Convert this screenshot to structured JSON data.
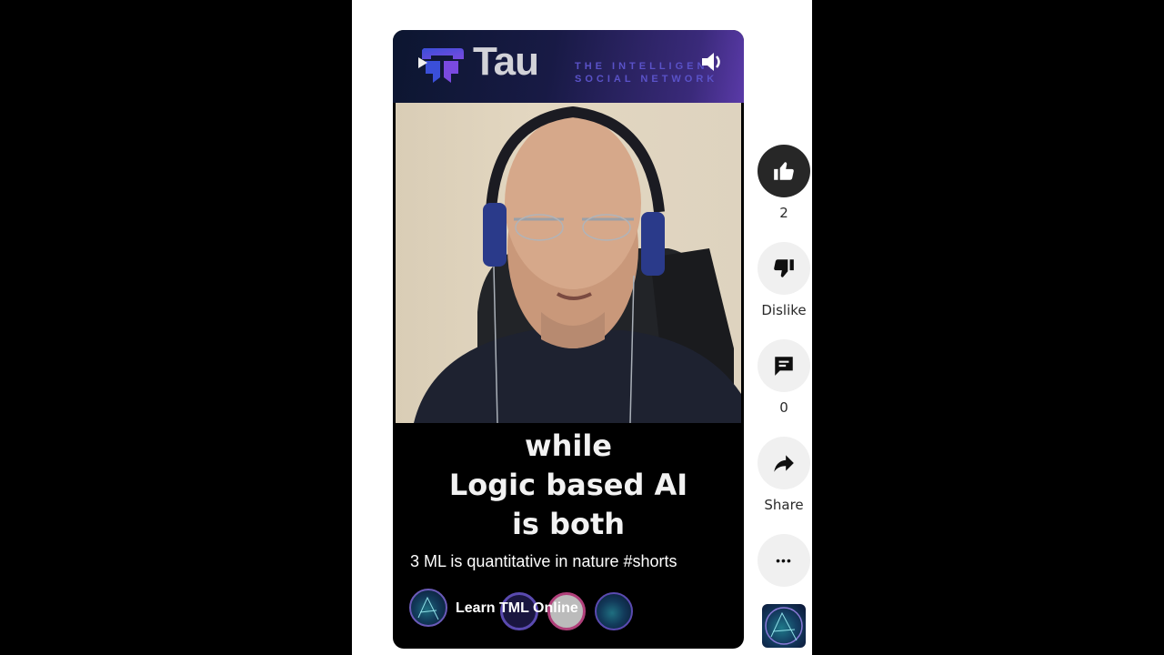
{
  "player": {
    "banner": {
      "brand": "Tau",
      "tagline_line1": "THE INTELLIGENT",
      "tagline_line2": "SOCIAL NETWORK",
      "colors": {
        "brand_text": "#d2d2d8",
        "tagline": "#5a52c8",
        "logo_blue": "#3a4fd8",
        "logo_purple": "#7a4ae0"
      }
    },
    "volume_icon": "volume-up-icon",
    "caption_lines": [
      "while",
      "Logic based AI",
      "is both"
    ],
    "video_title": "3 ML is quantitative in nature #shorts",
    "channel_name": "Learn TML Online"
  },
  "actions": {
    "like": {
      "icon": "thumbs-up-icon",
      "count": "2"
    },
    "dislike": {
      "icon": "thumbs-down-icon",
      "label": "Dislike"
    },
    "comments": {
      "icon": "comment-icon",
      "count": "0"
    },
    "share": {
      "icon": "share-icon",
      "label": "Share"
    },
    "more": {
      "icon": "more-horizontal-icon",
      "label": "•••"
    }
  }
}
